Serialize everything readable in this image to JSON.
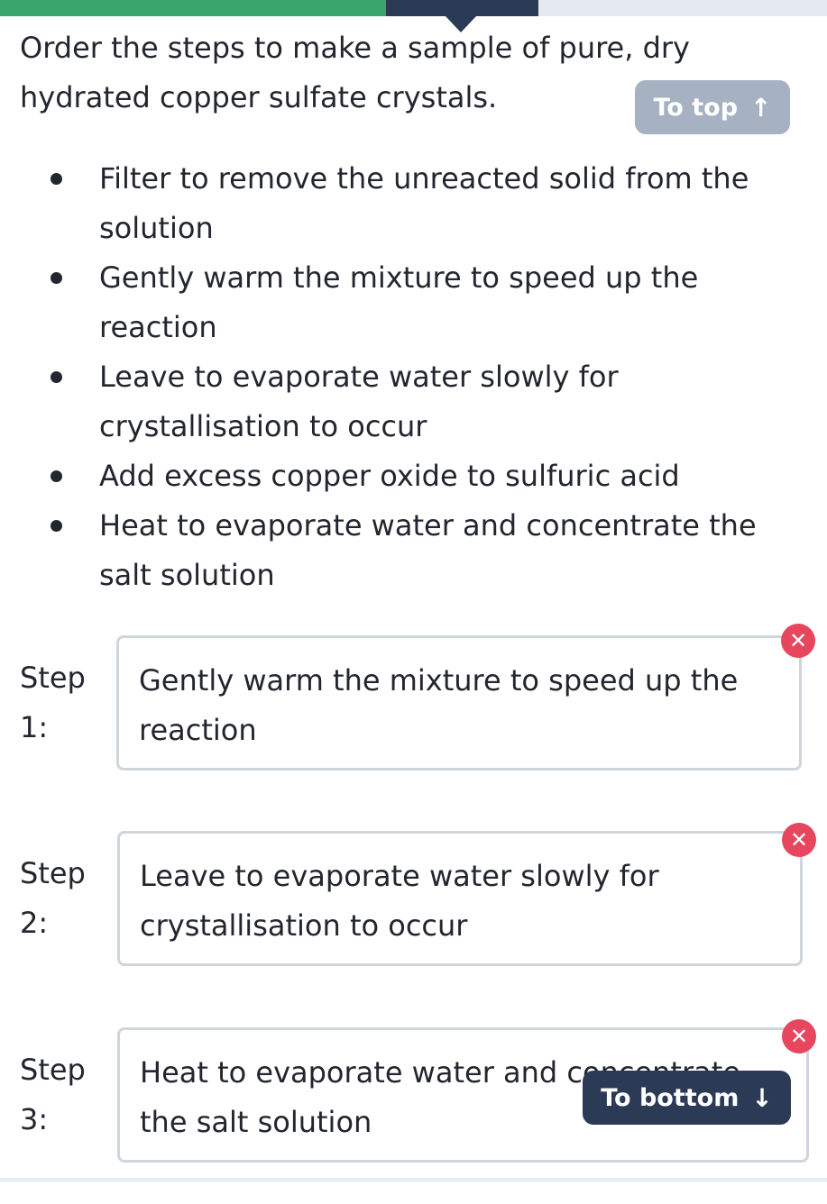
{
  "progress": {
    "segments": [
      "done",
      "current",
      "todo"
    ]
  },
  "question": "Order the steps to make a sample of pure, dry hydrated copper sulfate crystals.",
  "nav": {
    "to_top_label": "To top",
    "to_top_icon": "↑",
    "to_bottom_label": "To bottom",
    "to_bottom_icon": "↓"
  },
  "options": [
    "Filter to remove the unreacted solid from the solution",
    "Gently warm the mixture to speed up the reaction",
    "Leave to evaporate water slowly for crystallisation to occur",
    "Add excess copper oxide to sulfuric acid",
    "Heat to evaporate water and concentrate the salt solution"
  ],
  "slots": [
    {
      "label": "Step 1:",
      "value": "Gently warm the mixture to speed up the reaction"
    },
    {
      "label": "Step 2:",
      "value": "Leave to evaporate water slowly for crystallisation to occur"
    },
    {
      "label": "Step 3:",
      "value": "Heat to evaporate water and concentrate the salt solution"
    }
  ],
  "remove_icon": "✕",
  "colors": {
    "progress_done": "#3aa56d",
    "progress_current": "#2b3a55",
    "progress_todo": "#e4e9f1",
    "remove": "#e6475e",
    "to_top_bg": "#a6b1c2",
    "to_bottom_bg": "#2b3a55"
  }
}
